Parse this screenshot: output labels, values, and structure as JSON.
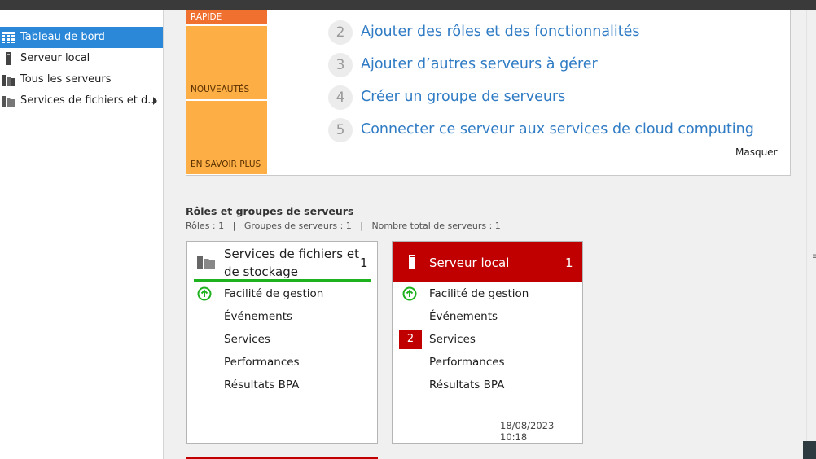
{
  "sidebar": {
    "items": [
      {
        "label": "Tableau de bord",
        "icon": "dashboard-grid-icon"
      },
      {
        "label": "Serveur local",
        "icon": "server-icon"
      },
      {
        "label": "Tous les serveurs",
        "icon": "servers-icon"
      },
      {
        "label": "Services de fichiers et d...",
        "icon": "file-services-icon"
      }
    ]
  },
  "quickstart": {
    "tiles": [
      "RAPIDE",
      "NOUVEAUTÉS",
      "EN SAVOIR PLUS"
    ],
    "steps": [
      {
        "number": "2",
        "label": "Ajouter des rôles et des fonctionnalités"
      },
      {
        "number": "3",
        "label": "Ajouter d’autres serveurs à gérer"
      },
      {
        "number": "4",
        "label": "Créer un groupe de serveurs"
      },
      {
        "number": "5",
        "label": "Connecter ce serveur aux services de cloud computing"
      }
    ],
    "hide_label": "Masquer"
  },
  "roles_section": {
    "title": "Rôles et groupes de serveurs",
    "stats": "Rôles : 1   |   Groupes de serveurs : 1   |   Nombre total de serveurs : 1"
  },
  "cards": [
    {
      "title_line1": "Services de fichiers et",
      "title_line2": "de stockage",
      "count": "1",
      "rows": [
        "Facilité de gestion",
        "Événements",
        "Services",
        "Performances",
        "Résultats BPA"
      ]
    },
    {
      "title": "Serveur local",
      "count": "1",
      "rows": [
        "Facilité de gestion",
        "Événements",
        "Services",
        "Performances",
        "Résultats BPA"
      ],
      "services_alert_count": "2",
      "timestamp": "18/08/2023 10:18"
    }
  ],
  "colors": {
    "selection": "#2b88d8",
    "tile_orange": "#f07030",
    "tile_amber": "#fdae45",
    "alert_red": "#c00000",
    "ok_green": "#1fb21f",
    "link_blue": "#2f7bc4"
  }
}
